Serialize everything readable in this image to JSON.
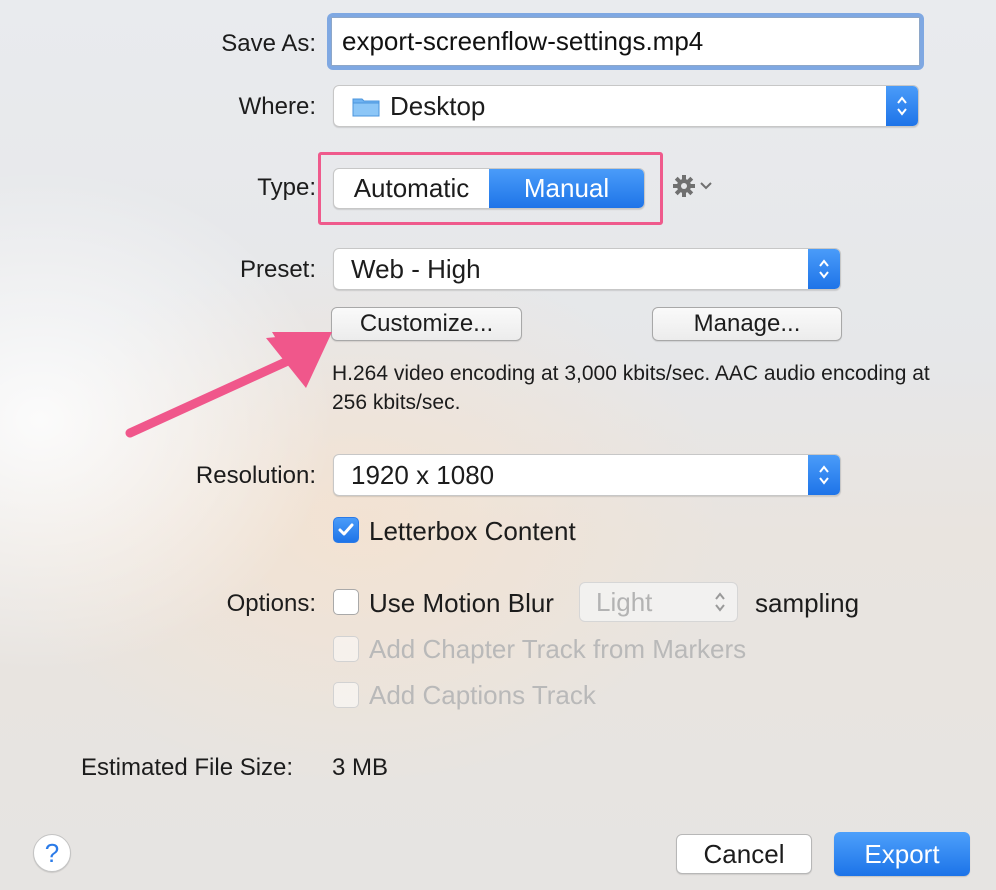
{
  "save_as": {
    "label": "Save As:",
    "value": "export-screenflow-settings.mp4"
  },
  "where": {
    "label": "Where:",
    "value": "Desktop",
    "icon": "folder-icon"
  },
  "type": {
    "label": "Type:",
    "options": [
      "Automatic",
      "Manual"
    ],
    "selected": "Manual"
  },
  "preset": {
    "label": "Preset:",
    "value": "Web - High"
  },
  "buttons": {
    "customize": "Customize...",
    "manage": "Manage..."
  },
  "description": "H.264 video encoding at 3,000 kbits/sec.  AAC audio encoding at 256 kbits/sec.",
  "resolution": {
    "label": "Resolution:",
    "value": "1920 x 1080"
  },
  "letterbox": {
    "label": "Letterbox Content",
    "checked": true
  },
  "options": {
    "label": "Options:",
    "motion_blur": {
      "label": "Use Motion Blur",
      "checked": false
    },
    "sampling_value": "Light",
    "sampling_label": "sampling",
    "chapter_track": {
      "label": "Add Chapter Track from Markers",
      "checked": false,
      "enabled": false
    },
    "captions_track": {
      "label": "Add Captions Track",
      "checked": false,
      "enabled": false
    }
  },
  "file_size": {
    "label": "Estimated File Size:",
    "value": "3 MB"
  },
  "footer": {
    "help": "?",
    "cancel": "Cancel",
    "export": "Export"
  },
  "colors": {
    "accent": "#2a7ae8",
    "highlight": "#ef5a8c"
  }
}
